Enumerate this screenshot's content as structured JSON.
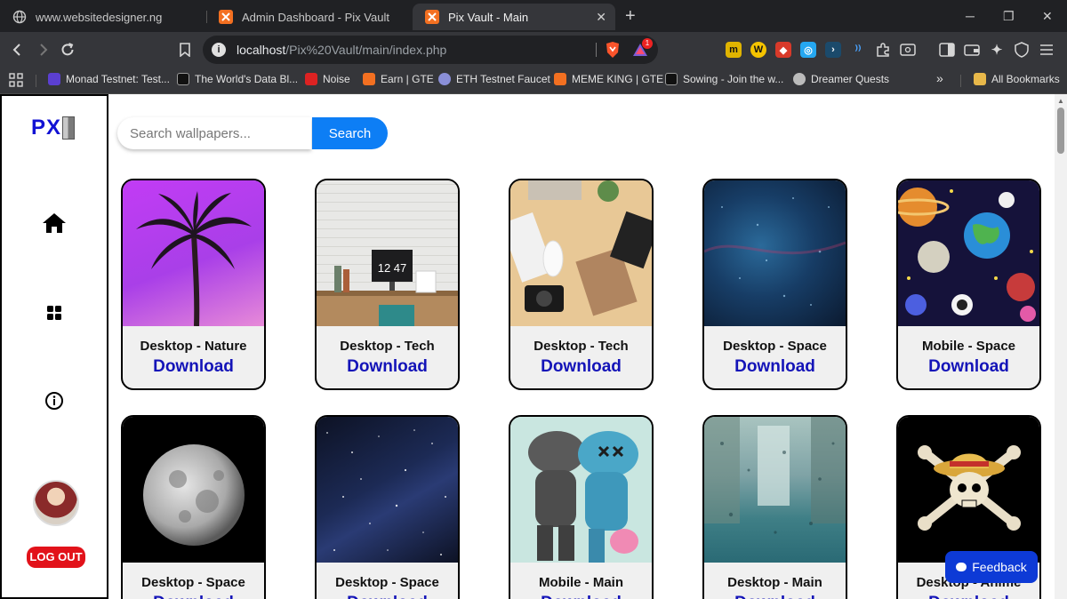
{
  "browser": {
    "tabs": [
      {
        "title": "www.websitedesigner.ng",
        "active": false
      },
      {
        "title": "Admin Dashboard - Pix Vault",
        "active": false
      },
      {
        "title": "Pix Vault - Main",
        "active": true
      }
    ],
    "url_host": "localhost",
    "url_path": "/Pix%20Vault/main/index.php",
    "bookmarks": [
      "Monad Testnet: Test...",
      "The World's Data Bl...",
      "Noise",
      "Earn | GTE",
      "ETH Testnet Faucet",
      "MEME KING | GTE",
      "Sowing - Join the w...",
      "Dreamer Quests"
    ],
    "all_bookmarks": "All Bookmarks",
    "more": "»",
    "new_tab": "+",
    "close_tab": "✕",
    "min": "─",
    "restore": "❐",
    "close": "✕",
    "ext_badge": "1"
  },
  "app": {
    "logo": "PX",
    "logout": "LOG OUT",
    "search_placeholder": "Search wallpapers...",
    "search_button": "Search",
    "feedback": "Feedback",
    "download_label": "Download",
    "cards": [
      {
        "caption": "Desktop - Nature"
      },
      {
        "caption": "Desktop - Tech"
      },
      {
        "caption": "Desktop - Tech"
      },
      {
        "caption": "Desktop - Space"
      },
      {
        "caption": "Mobile - Space"
      },
      {
        "caption": "Desktop - Space"
      },
      {
        "caption": "Desktop - Space"
      },
      {
        "caption": "Mobile - Main"
      },
      {
        "caption": "Desktop - Main"
      },
      {
        "caption": "Desktop - Anime"
      }
    ],
    "clock_text": "12 47"
  },
  "colors": {
    "accent": "#0d7ef5",
    "logo": "#1212d4",
    "download": "#1414b8",
    "logout": "#e2121a",
    "feedback": "#0d3ad6"
  }
}
